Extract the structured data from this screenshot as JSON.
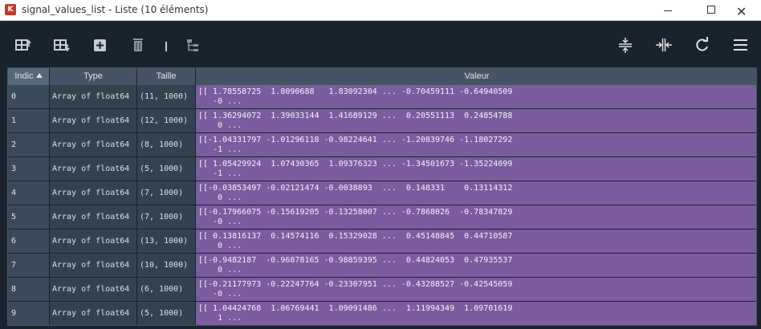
{
  "window": {
    "title": "signal_values_list - Liste (10 éléments)",
    "app_icon_glyph": "K",
    "minimize": "minimize",
    "maximize": "maximize",
    "close_glyph": "✕"
  },
  "toolbar": {
    "icons": [
      "insert-row-above-icon",
      "insert-row-below-icon",
      "add-icon",
      "delete-icon",
      "tree-icon",
      "resize-rows-icon",
      "resize-columns-icon",
      "refresh-icon",
      "menu-icon"
    ]
  },
  "table": {
    "headers": {
      "index": "Indic",
      "type": "Type",
      "size": "Taille",
      "value": "Valeur"
    },
    "rows": [
      {
        "index": "0",
        "type": "Array of float64",
        "size": "(11, 1000)",
        "line1": "[[ 1.78558725  1.8090688   1.83092304 ... -0.70459111 -0.64940509",
        "line2": "   -0 ..."
      },
      {
        "index": "1",
        "type": "Array of float64",
        "size": "(12, 1000)",
        "line1": "[[ 1.36294072  1.39033144  1.41689129 ...  0.20551113  0.24854788",
        "line2": "    0 ..."
      },
      {
        "index": "2",
        "type": "Array of float64",
        "size": "(8, 1000)",
        "line1": "[[-1.04331797 -1.01296118 -0.98224641 ... -1.20839746 -1.18027292",
        "line2": "   -1 ..."
      },
      {
        "index": "3",
        "type": "Array of float64",
        "size": "(5, 1000)",
        "line1": "[[ 1.05429924  1.07430365  1.09376323 ... -1.34501673 -1.35224099",
        "line2": "   -1 ..."
      },
      {
        "index": "4",
        "type": "Array of float64",
        "size": "(7, 1000)",
        "line1": "[[-0.03853497 -0.02121474 -0.0038893  ...  0.148331    0.13114312",
        "line2": "    0 ..."
      },
      {
        "index": "5",
        "type": "Array of float64",
        "size": "(7, 1000)",
        "line1": "[[-0.17966075 -0.15619205 -0.13258007 ... -0.7868026  -0.78347829",
        "line2": "   -0 ..."
      },
      {
        "index": "6",
        "type": "Array of float64",
        "size": "(13, 1000)",
        "line1": "[[ 0.13816137  0.14574116  0.15329028 ...  0.45148845  0.44710587",
        "line2": "    0 ..."
      },
      {
        "index": "7",
        "type": "Array of float64",
        "size": "(10, 1000)",
        "line1": "[[-0.9482187  -0.96878165 -0.98859395 ...  0.44824053  0.47935537",
        "line2": "    0 ..."
      },
      {
        "index": "8",
        "type": "Array of float64",
        "size": "(6, 1000)",
        "line1": "[[-0.21177973 -0.22247764 -0.23307951 ... -0.43288527 -0.42545059",
        "line2": "   -0 ..."
      },
      {
        "index": "9",
        "type": "Array of float64",
        "size": "(5, 1000)",
        "line1": "[[ 1.04424768  1.06769441  1.09091486 ...  1.11994349  1.09701619",
        "line2": "    1 ..."
      }
    ]
  },
  "colors": {
    "background": "#19232d",
    "header": "#455364",
    "value_cell": "#7b5c9e",
    "index_cell": "#3a4a59",
    "type_cell": "#33424f",
    "text": "#e0e1e3"
  }
}
